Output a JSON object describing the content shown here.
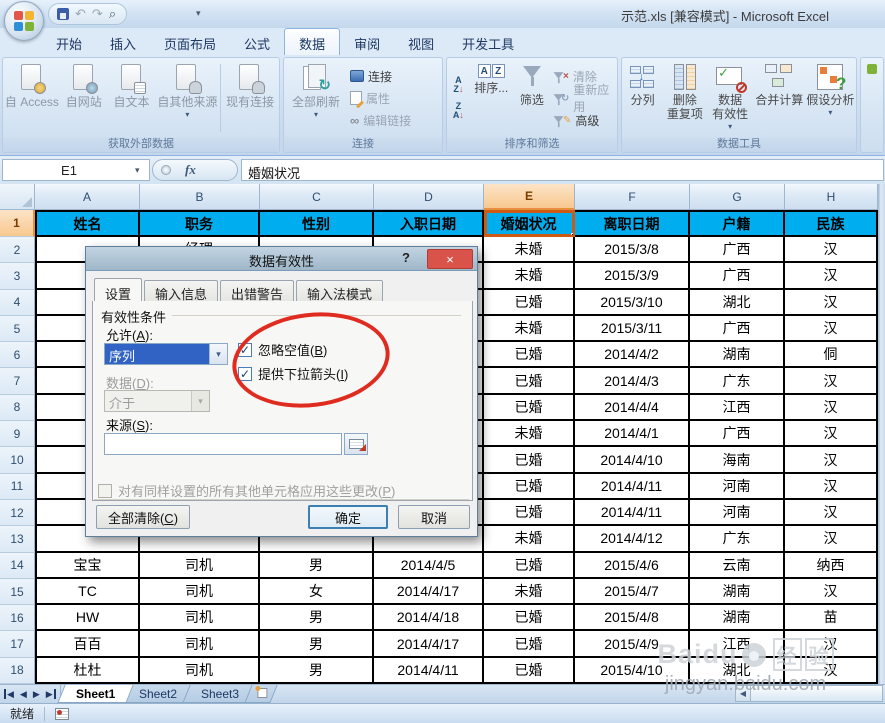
{
  "window": {
    "title": "示范.xls  [兼容模式] - Microsoft Excel"
  },
  "icons": {
    "help": "?",
    "close": "×",
    "check": "✓",
    "dropdown": "▾",
    "refresh": "↻",
    "undo": "↶",
    "redo": "↷",
    "links": "∞",
    "fx": "fx",
    "sort_down": "↓",
    "nav_prev": "◀",
    "nav_next": "▶"
  },
  "ribbon": {
    "tabs": [
      "开始",
      "插入",
      "页面布局",
      "公式",
      "数据",
      "审阅",
      "视图",
      "开发工具"
    ],
    "tab_keys": [
      "home",
      "insert",
      "page-layout",
      "formulas",
      "data",
      "review",
      "view",
      "developer"
    ],
    "active_tab": "数据",
    "groups": {
      "get_external": {
        "label": "获取外部数据",
        "from_access": "自 Access",
        "from_web": "自网站",
        "from_text": "自文本",
        "from_other": "自其他来源",
        "existing_connections": "现有连接"
      },
      "connections": {
        "label": "连接",
        "refresh_all": "全部刷新",
        "connections": "连接",
        "properties": "属性",
        "edit_links": "编辑链接"
      },
      "sort_filter": {
        "label": "排序和筛选",
        "sort": "排序...",
        "filter": "筛选",
        "clear": "清除",
        "reapply": "重新应用",
        "advanced": "高级"
      },
      "data_tools": {
        "label": "数据工具",
        "text_to_columns": "分列",
        "remove_duplicates": "删除\n重复项",
        "data_validation": "数据\n有效性",
        "consolidate": "合并计算",
        "what_if": "假设分析"
      }
    }
  },
  "formula_bar": {
    "name_box": "E1",
    "formula": "婚姻状况"
  },
  "grid": {
    "col_letters": [
      "A",
      "B",
      "C",
      "D",
      "E",
      "F",
      "G",
      "H"
    ],
    "selected_col": "E",
    "selected_row": 1,
    "selected_cell": "E1",
    "header_row": [
      "姓名",
      "职务",
      "性别",
      "入职日期",
      "婚姻状况",
      "离职日期",
      "户籍",
      "民族"
    ],
    "rows": [
      {
        "n": 2,
        "cells": [
          "",
          "经理",
          "",
          "",
          "未婚",
          "2015/3/8",
          "广西",
          "汉"
        ]
      },
      {
        "n": 3,
        "cells": [
          "",
          "",
          "",
          "",
          "未婚",
          "2015/3/9",
          "广西",
          "汉"
        ]
      },
      {
        "n": 4,
        "cells": [
          "",
          "",
          "",
          "",
          "已婚",
          "2015/3/10",
          "湖北",
          "汉"
        ]
      },
      {
        "n": 5,
        "cells": [
          "",
          "",
          "",
          "",
          "未婚",
          "2015/3/11",
          "广西",
          "汉"
        ]
      },
      {
        "n": 6,
        "cells": [
          "",
          "",
          "",
          "",
          "已婚",
          "2014/4/2",
          "湖南",
          "侗"
        ]
      },
      {
        "n": 7,
        "cells": [
          "",
          "",
          "",
          "",
          "已婚",
          "2014/4/3",
          "广东",
          "汉"
        ]
      },
      {
        "n": 8,
        "cells": [
          "",
          "",
          "",
          "",
          "已婚",
          "2014/4/4",
          "江西",
          "汉"
        ]
      },
      {
        "n": 9,
        "cells": [
          "",
          "",
          "",
          "",
          "未婚",
          "2014/4/1",
          "广西",
          "汉"
        ]
      },
      {
        "n": 10,
        "cells": [
          "",
          "",
          "",
          "",
          "已婚",
          "2014/4/10",
          "海南",
          "汉"
        ]
      },
      {
        "n": 11,
        "cells": [
          "",
          "",
          "",
          "",
          "已婚",
          "2014/4/11",
          "河南",
          "汉"
        ]
      },
      {
        "n": 12,
        "cells": [
          "",
          "",
          "",
          "",
          "已婚",
          "2014/4/11",
          "河南",
          "汉"
        ]
      },
      {
        "n": 13,
        "cells": [
          "",
          "",
          "",
          "",
          "未婚",
          "2014/4/12",
          "广东",
          "汉"
        ]
      },
      {
        "n": 14,
        "cells": [
          "宝宝",
          "司机",
          "男",
          "2014/4/5",
          "已婚",
          "2015/4/6",
          "云南",
          "纳西"
        ]
      },
      {
        "n": 15,
        "cells": [
          "TC",
          "司机",
          "女",
          "2014/4/17",
          "未婚",
          "2015/4/7",
          "湖南",
          "汉"
        ]
      },
      {
        "n": 16,
        "cells": [
          "HW",
          "司机",
          "男",
          "2014/4/18",
          "已婚",
          "2015/4/8",
          "湖南",
          "苗"
        ]
      },
      {
        "n": 17,
        "cells": [
          "百百",
          "司机",
          "男",
          "2014/4/17",
          "已婚",
          "2015/4/9",
          "江西",
          "汉"
        ]
      },
      {
        "n": 18,
        "cells": [
          "杜杜",
          "司机",
          "男",
          "2014/4/11",
          "已婚",
          "2015/4/10",
          "湖北",
          "汉"
        ]
      }
    ]
  },
  "dialog": {
    "title": "数据有效性",
    "tabs": [
      "设置",
      "输入信息",
      "出错警告",
      "输入法模式"
    ],
    "active_tab": "设置",
    "validation_criteria": "有效性条件",
    "allow_label": "允许(A):",
    "allow_value": "序列",
    "ignore_blank": "忽略空值(B)",
    "provide_dropdown": "提供下拉箭头(I)",
    "data_label": "数据(D):",
    "data_value": "介于",
    "source_label": "来源(S):",
    "source_value": "",
    "apply_all": "对有同样设置的所有其他单元格应用这些更改(P)",
    "clear_all": "全部清除(C)",
    "ok": "确定",
    "cancel": "取消"
  },
  "sheet_bar": {
    "tabs": [
      "Sheet1",
      "Sheet2",
      "Sheet3"
    ],
    "active": "Sheet1"
  },
  "status_bar": {
    "ready": "就绪"
  },
  "watermark": {
    "brand": "Baidu",
    "suffix": "经验",
    "url": "jingyan.baidu.com"
  },
  "colors": {
    "table_header_fill": "#00AEEF",
    "selection_border": "#CE5B13",
    "selected_header": "#F8C88E",
    "annotation_red": "#E02B20",
    "dialog_close_red": "#D9534A",
    "allow_selected_fill": "#3163C5"
  }
}
